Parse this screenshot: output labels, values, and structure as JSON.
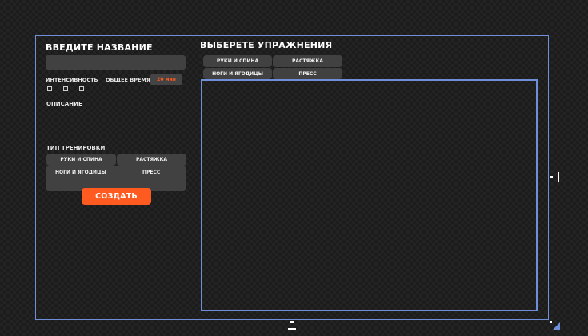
{
  "form": {
    "name_title": "ВВЕДИТЕ НАЗВАНИЕ",
    "name_value": "",
    "intensity_label": "ИНТЕНСИВНОСТЬ",
    "total_time_label": "ОБЩЕЕ ВРЕМЯ",
    "total_time_value": "20 мин",
    "description_label": "ОПИСАНИЕ",
    "workout_type_label": "ТИП ТРЕНИРОВКИ",
    "workout_types": [
      "РУКИ И СПИНА",
      "РАСТЯЖКА",
      "НОГИ И ЯГОДИЦЫ",
      "ПРЕСС"
    ],
    "create_label": "СОЗДАТЬ"
  },
  "exercises": {
    "title": "ВЫБЕРЕТЕ УПРАЖНЕНИЯ",
    "categories": [
      "РУКИ И СПИНА",
      "РАСТЯЖКА",
      "НОГИ И ЯГОДИЦЫ",
      "ПРЕСС"
    ]
  },
  "colors": {
    "accent": "#ff5a1f",
    "selection": "#6f8fd8",
    "panel": "#414141",
    "background": "#1c1c1c"
  }
}
